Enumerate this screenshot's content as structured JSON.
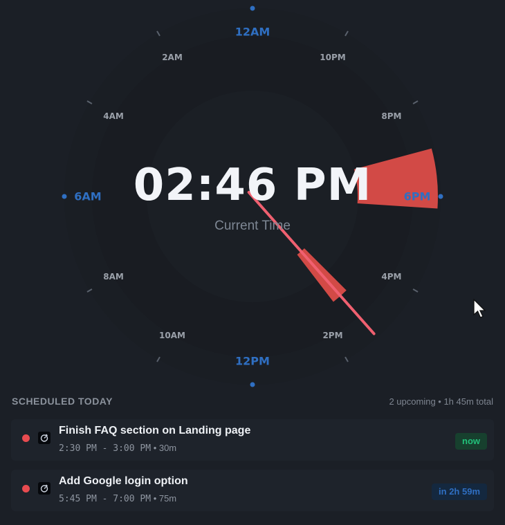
{
  "clock": {
    "time": "02:46 PM",
    "subtitle": "Current Time",
    "hour_labels": [
      "12PM",
      "2PM",
      "4PM",
      "6PM",
      "8PM",
      "10PM",
      "12AM",
      "2AM",
      "4AM",
      "6AM",
      "8AM",
      "10AM"
    ],
    "major_labels": [
      "12PM",
      "6PM",
      "12AM",
      "6AM"
    ],
    "hand_color": "#f06070",
    "event_color": "#d24a46",
    "accent_color": "#2f6fc2"
  },
  "schedule": {
    "title": "SCHEDULED TODAY",
    "summary": "2 upcoming • 1h 45m total",
    "items": [
      {
        "title": "Finish FAQ section on Landing page",
        "time_range": "2:30 PM - 3:00 PM",
        "duration": "• 30m",
        "badge": "now",
        "icon": "timer-icon"
      },
      {
        "title": "Add Google login option",
        "time_range": "5:45 PM - 7:00 PM",
        "duration": "• 75m",
        "badge": "in 2h 59m",
        "icon": "timer-icon"
      }
    ]
  }
}
